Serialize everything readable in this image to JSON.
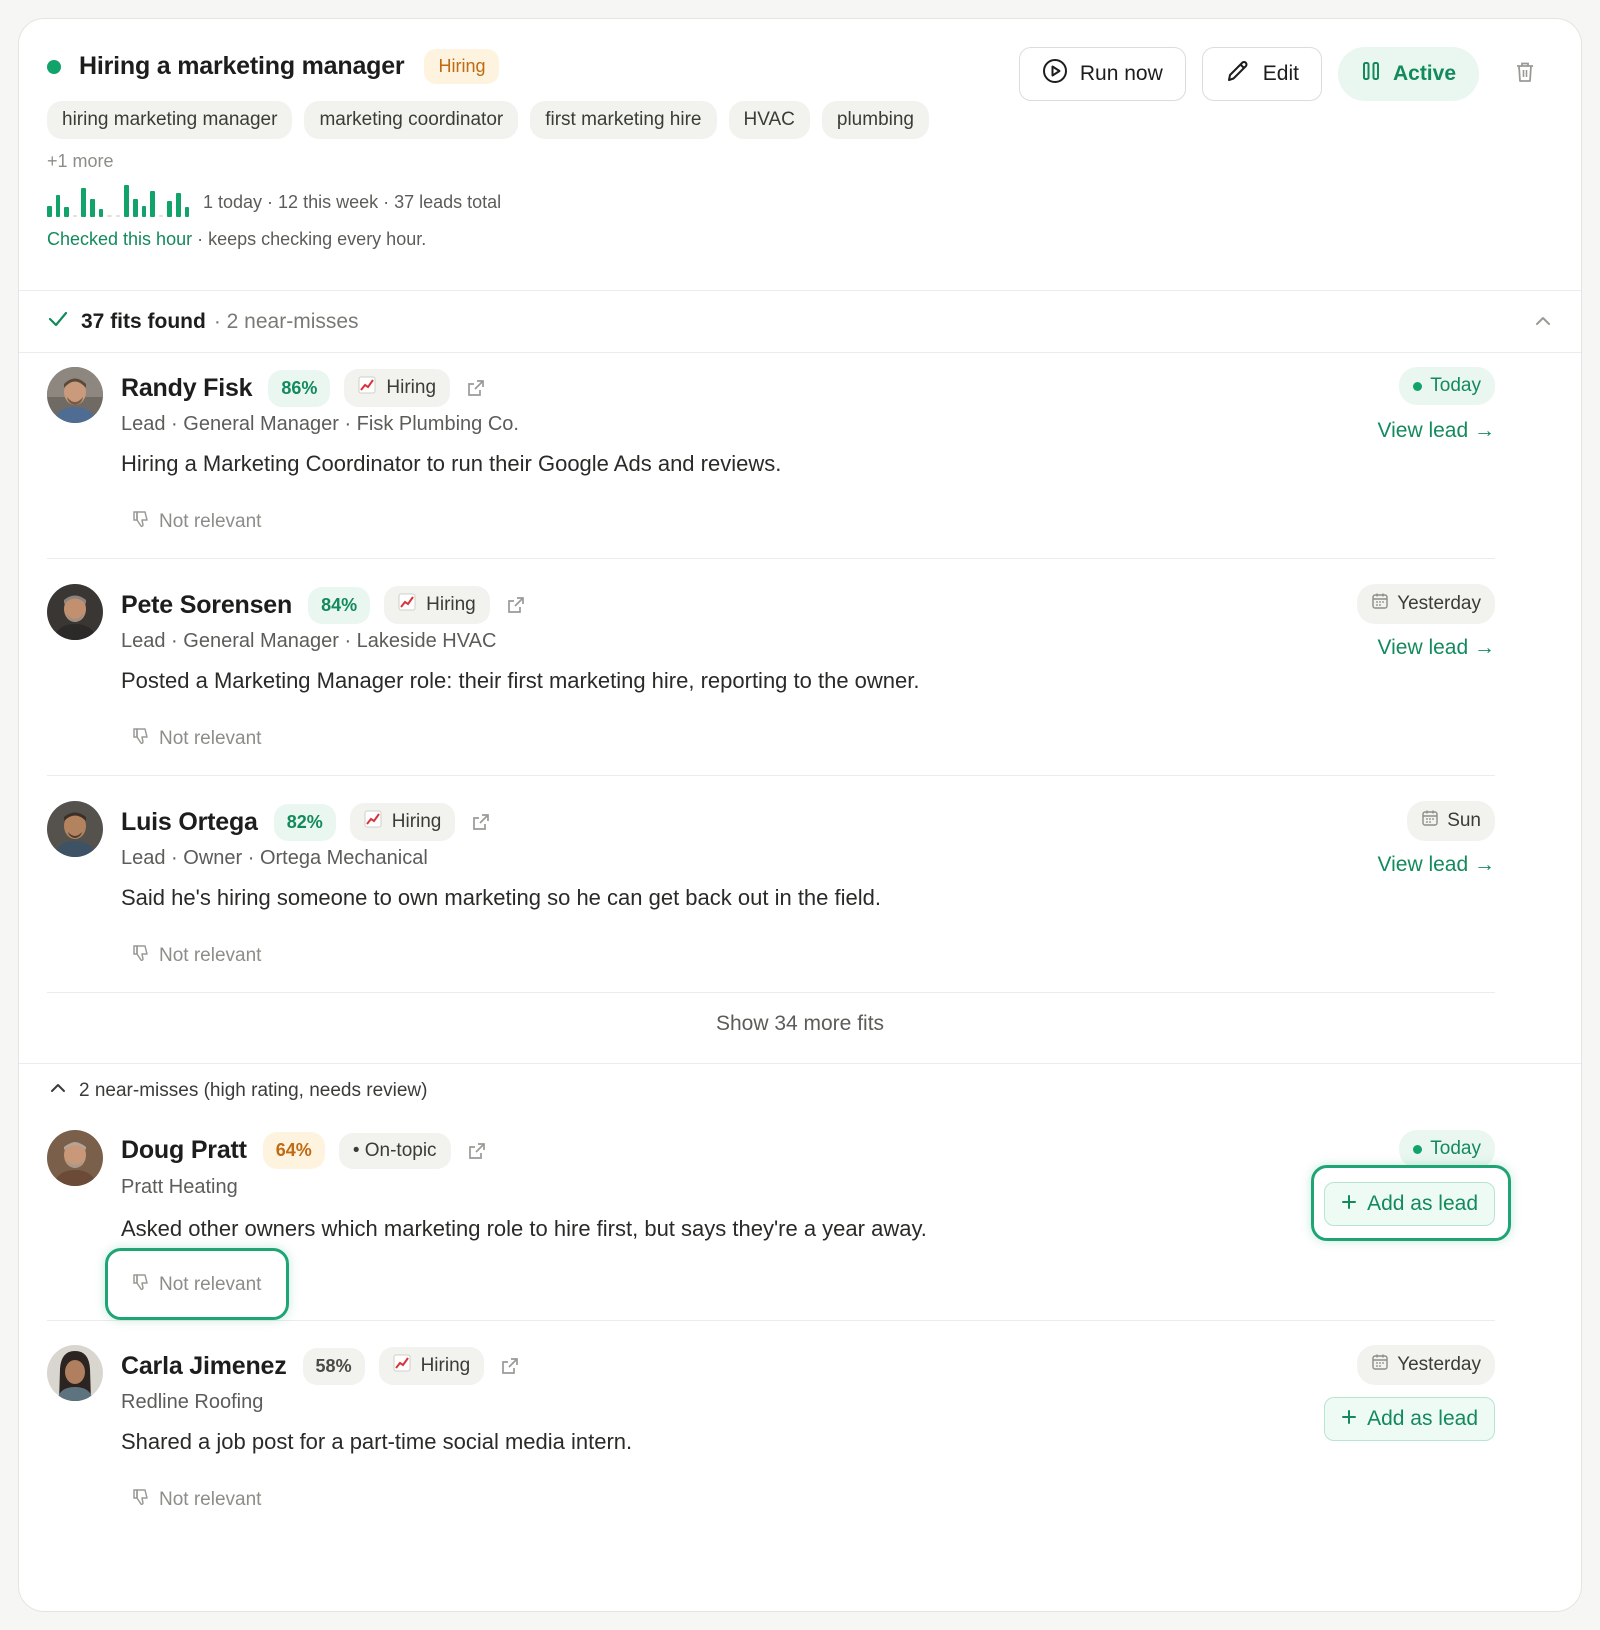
{
  "header": {
    "title": "Hiring a marketing manager",
    "type_badge": "Hiring",
    "tags": [
      "hiring marketing manager",
      "marketing coordinator",
      "first marketing hire",
      "HVAC",
      "plumbing"
    ],
    "more_tags": "+1 more",
    "activity_bars": [
      0.35,
      0.7,
      0.3,
      0,
      0.9,
      0.55,
      0.25,
      0,
      0,
      1.0,
      0.55,
      0.35,
      0.8,
      0,
      0.5,
      0.75,
      0.3
    ],
    "stats": "1 today · 12 this week · 37 leads total",
    "checked": "Checked this hour",
    "checked_sub": " · keeps checking every hour.",
    "run_label": "Run now",
    "edit_label": "Edit",
    "active_label": "Active"
  },
  "fits": {
    "count": "37 fits found",
    "near": "· 2 near-misses"
  },
  "leads": [
    {
      "name": "Randy Fisk",
      "score": "86%",
      "source": "Hiring",
      "meta": "Lead · General Manager · Fisk Plumbing Co.",
      "desc": "Hiring a Marketing Coordinator to run their Google Ads and reviews.",
      "when": "Today",
      "action": "View lead →",
      "not_relevant": "Not relevant"
    },
    {
      "name": "Pete Sorensen",
      "score": "84%",
      "source": "Hiring",
      "meta": "Lead · General Manager · Lakeside HVAC",
      "desc": "Posted a Marketing Manager role: their first marketing hire, reporting to the owner.",
      "when": "Yesterday",
      "action": "View lead →",
      "not_relevant": "Not relevant"
    },
    {
      "name": "Luis Ortega",
      "score": "82%",
      "source": "Hiring",
      "meta": "Lead · Owner · Ortega Mechanical",
      "desc": "Said he's hiring someone to own marketing so he can get back out in the field.",
      "when": "Sun",
      "action": "View lead →",
      "not_relevant": "Not relevant"
    }
  ],
  "show_more": "Show 34 more fits",
  "near_misses": {
    "heading": "2 near-misses (high rating, needs review)",
    "items": [
      {
        "name": "Doug Pratt",
        "score": "64%",
        "source": "• On-topic",
        "meta": "Pratt Heating",
        "desc": "Asked other owners which marketing role to hire first, but says they're a year away.",
        "when": "Today",
        "action": "Add as lead",
        "not_relevant": "Not relevant"
      },
      {
        "name": "Carla Jimenez",
        "score": "58%",
        "source": "Hiring",
        "meta": "Redline Roofing",
        "desc": "Shared a job post for a part-time social media intern.",
        "when": "Yesterday",
        "action": "Add as lead",
        "not_relevant": "Not relevant"
      }
    ]
  },
  "colors": {
    "accent": "#138a5c",
    "accent_bg": "#e9f7f0",
    "warn": "#c06a12",
    "warn_bg": "#fdf3df"
  }
}
